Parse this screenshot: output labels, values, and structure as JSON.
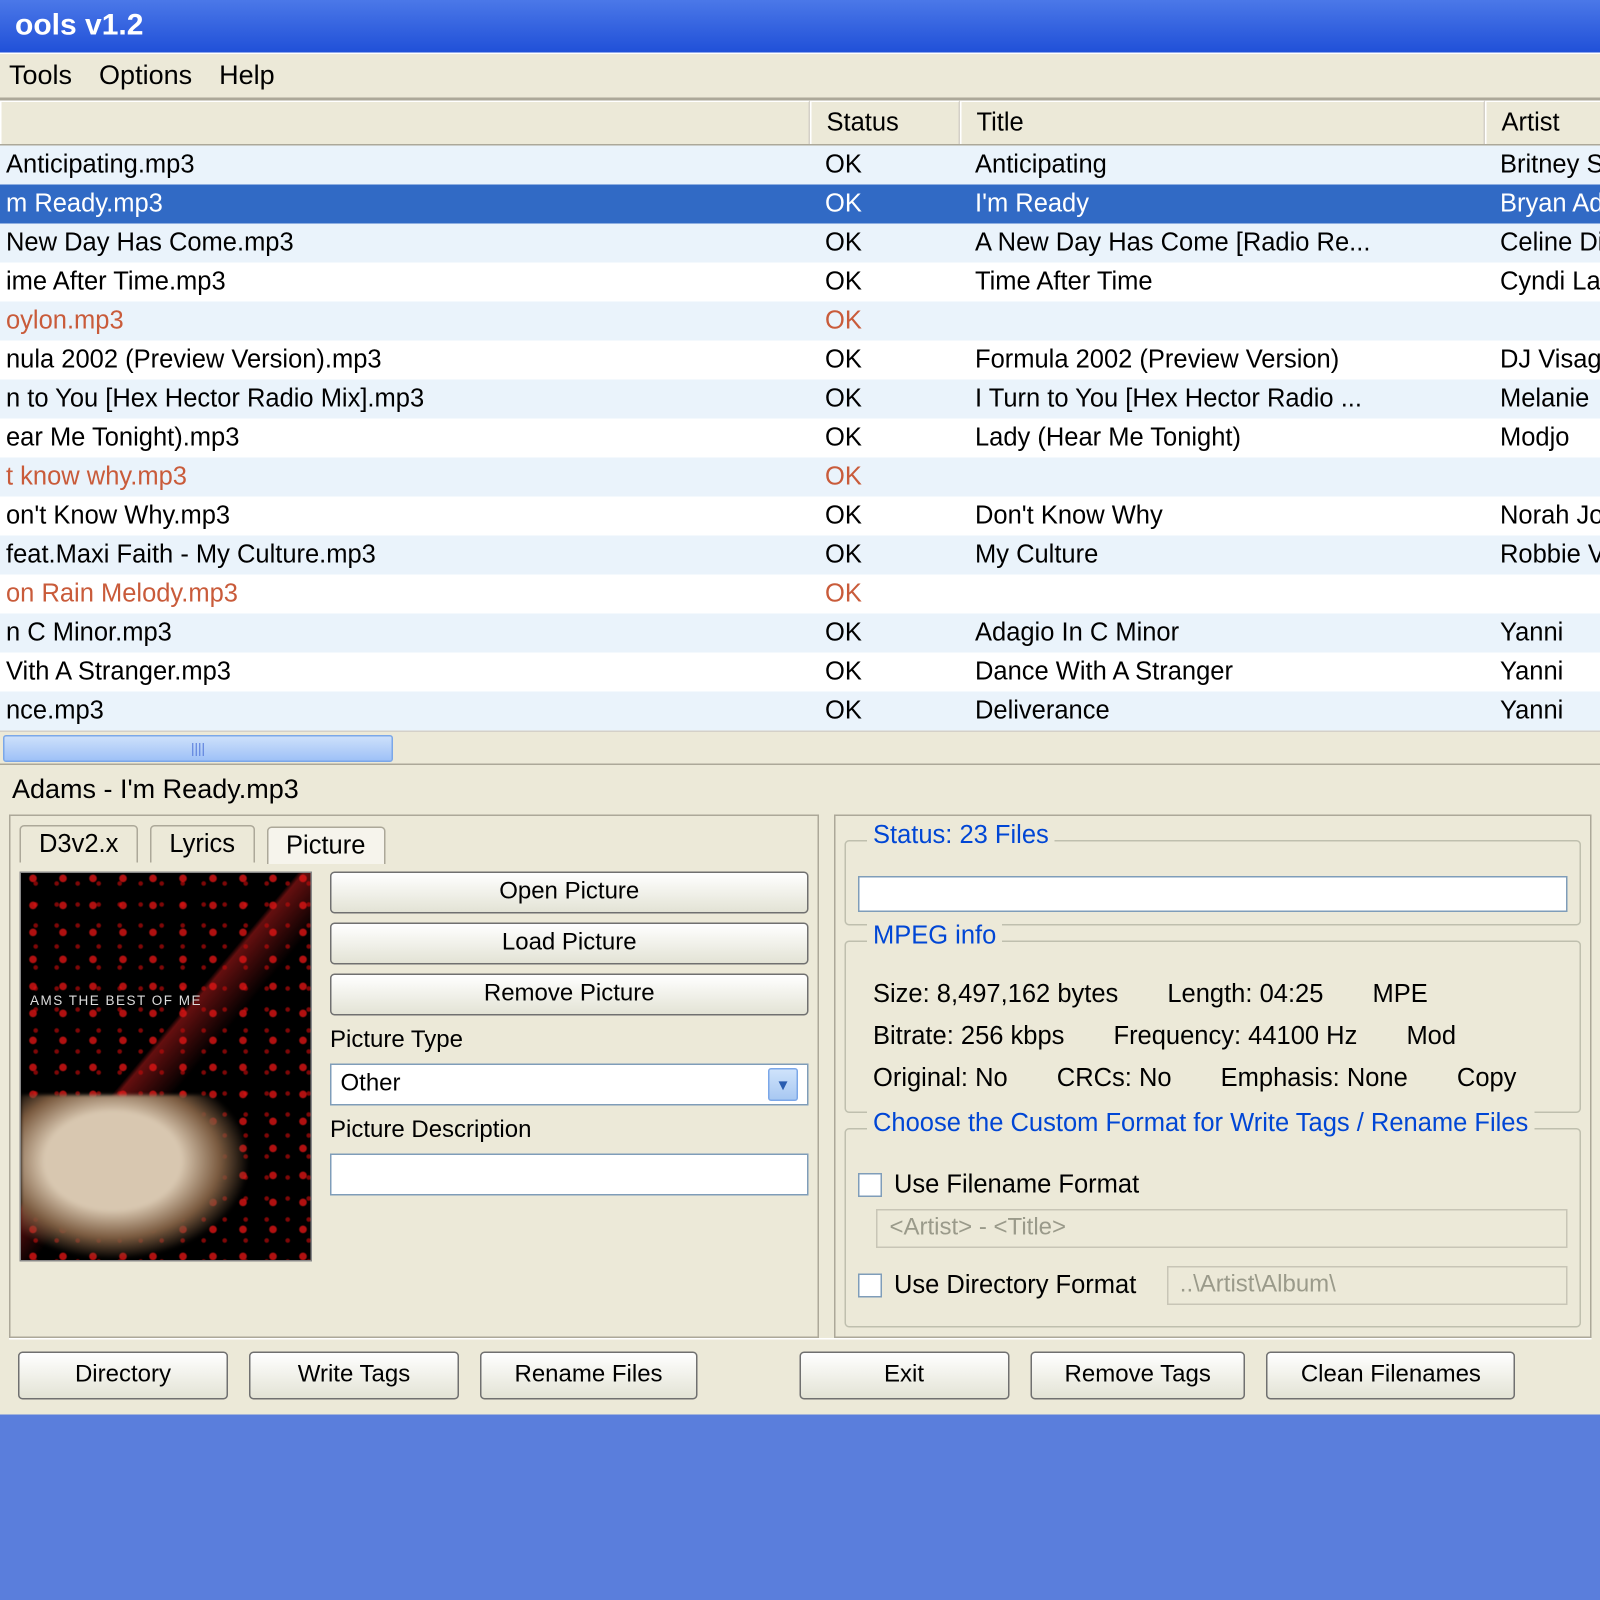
{
  "window": {
    "title": "ools v1.2"
  },
  "menu": {
    "tools": "Tools",
    "options": "Options",
    "help": "Help"
  },
  "columns": {
    "file": "",
    "status": "Status",
    "title": "Title",
    "artist": "Artist"
  },
  "rows": [
    {
      "file": "Anticipating.mp3",
      "status": "OK",
      "title": "Anticipating",
      "artist": "Britney S",
      "alt": true
    },
    {
      "file": "m Ready.mp3",
      "status": "OK",
      "title": "I'm Ready",
      "artist": "Bryan Ad",
      "sel": true
    },
    {
      "file": "New Day Has Come.mp3",
      "status": "OK",
      "title": "A New Day Has Come [Radio Re...",
      "artist": "Celine Di",
      "alt": true
    },
    {
      "file": "ime After Time.mp3",
      "status": "OK",
      "title": "Time After Time",
      "artist": "Cyndi La"
    },
    {
      "file": "oylon.mp3",
      "status": "OK",
      "title": "",
      "artist": "",
      "warn": true,
      "alt": true
    },
    {
      "file": "nula 2002 (Preview Version).mp3",
      "status": "OK",
      "title": "Formula 2002 (Preview Version)",
      "artist": "DJ Visag"
    },
    {
      "file": "n to You [Hex Hector Radio Mix].mp3",
      "status": "OK",
      "title": "I Turn to You [Hex Hector Radio ...",
      "artist": "Melanie",
      "alt": true
    },
    {
      "file": "ear Me Tonight).mp3",
      "status": "OK",
      "title": "Lady (Hear Me Tonight)",
      "artist": "Modjo"
    },
    {
      "file": "t know why.mp3",
      "status": "OK",
      "title": "",
      "artist": "",
      "warn": true,
      "alt": true
    },
    {
      "file": "on't Know Why.mp3",
      "status": "OK",
      "title": "Don't Know Why",
      "artist": "Norah Jo"
    },
    {
      "file": "feat.Maxi Faith - My Culture.mp3",
      "status": "OK",
      "title": "My Culture",
      "artist": "Robbie V",
      "alt": true
    },
    {
      "file": "on Rain Melody.mp3",
      "status": "OK",
      "title": "",
      "artist": "",
      "warn": true
    },
    {
      "file": "n C Minor.mp3",
      "status": "OK",
      "title": "Adagio In C Minor",
      "artist": "Yanni",
      "alt": true
    },
    {
      "file": "Vith A Stranger.mp3",
      "status": "OK",
      "title": "Dance With A Stranger",
      "artist": "Yanni"
    },
    {
      "file": "nce.mp3",
      "status": "OK",
      "title": "Deliverance",
      "artist": "Yanni",
      "alt": true
    }
  ],
  "selected_file": "Adams - I'm Ready.mp3",
  "tabs": {
    "id3v2": "D3v2.x",
    "lyrics": "Lyrics",
    "picture": "Picture"
  },
  "picture": {
    "open": "Open Picture",
    "load": "Load Picture",
    "remove": "Remove Picture",
    "type_label": "Picture Type",
    "type_value": "Other",
    "desc_label": "Picture Description",
    "desc_value": "",
    "art_caption": "AMS THE BEST OF ME"
  },
  "status": {
    "label": "Status: 23 Files"
  },
  "mpeg": {
    "title": "MPEG info",
    "size_l": "Size:",
    "size_v": "8,497,162 bytes",
    "len_l": "Length:",
    "len_v": "04:25",
    "mpe_l": "MPE",
    "bitrate_l": "Bitrate:",
    "bitrate_v": "256 kbps",
    "freq_l": "Frequency:",
    "freq_v": "44100 Hz",
    "mode_l": "Mod",
    "orig_l": "Original:",
    "orig_v": "No",
    "crc_l": "CRCs:",
    "crc_v": "No",
    "emph_l": "Emphasis:",
    "emph_v": "None",
    "copy_l": "Copy"
  },
  "format": {
    "title": "Choose the Custom Format for Write Tags / Rename Files",
    "use_filename": "Use Filename Format",
    "filename_fmt": "<Artist> - <Title>",
    "use_dir": "Use Directory Format",
    "dir_fmt": "..\\Artist\\Album\\"
  },
  "buttons": {
    "directory": "Directory",
    "write_tags": "Write Tags",
    "rename_files": "Rename Files",
    "exit": "Exit",
    "remove_tags": "Remove Tags",
    "clean_filenames": "Clean Filenames"
  }
}
